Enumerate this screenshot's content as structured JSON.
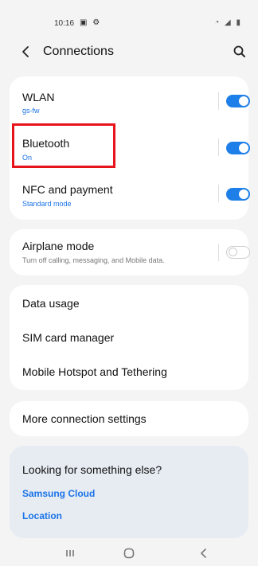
{
  "status_bar": {
    "time": "10:16",
    "left_icons": "▣ ⚙",
    "right_icons": "◔ ◢ ▮"
  },
  "header": {
    "title": "Connections",
    "back_icon": "chevron-left-icon",
    "search_icon": "search-icon"
  },
  "groups": {
    "wireless": [
      {
        "label": "WLAN",
        "subtitle": "gs-fw",
        "toggle_on": true
      },
      {
        "label": "Bluetooth",
        "subtitle": "On",
        "toggle_on": true
      },
      {
        "label": "NFC and payment",
        "subtitle": "Standard mode",
        "toggle_on": true
      }
    ],
    "airplane": {
      "label": "Airplane mode",
      "subtitle": "Turn off calling, messaging, and Mobile data.",
      "toggle_on": false
    },
    "network": [
      {
        "label": "Data usage"
      },
      {
        "label": "SIM card manager"
      },
      {
        "label": "Mobile Hotspot and Tethering"
      }
    ],
    "more": {
      "label": "More connection settings"
    }
  },
  "help": {
    "title": "Looking for something else?",
    "links": [
      "Samsung Cloud",
      "Location"
    ]
  },
  "colors": {
    "accent": "#1f7fe8",
    "highlight": "#e8141c",
    "help_bg": "#e7ecf3"
  }
}
